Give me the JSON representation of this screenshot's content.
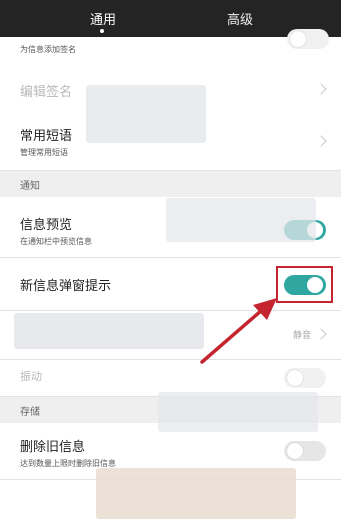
{
  "tabs": [
    {
      "label": "通用"
    },
    {
      "label": "高级"
    }
  ],
  "rows": {
    "signature_sub": "为信息添加签名",
    "edit_signature": "编辑签名",
    "common_phrases": {
      "title": "常用短语",
      "sub": "管理常用短语"
    },
    "preview": {
      "title": "信息预览",
      "sub": "在通知栏中预览信息"
    },
    "popup": {
      "title": "新信息弹窗提示"
    },
    "ringtone_value": "静音",
    "vibrate": {
      "title": "振动"
    },
    "delete_old": {
      "title": "删除旧信息",
      "sub": "达到数量上限时删除旧信息"
    }
  },
  "sections": {
    "notify": "通知",
    "storage": "存储"
  },
  "toggles": {
    "signature": false,
    "preview": true,
    "popup": true,
    "vibrate": false,
    "delete_old": false
  },
  "colors": {
    "tab_bar": "#242424",
    "toggle_on": "#2fa7a0",
    "highlight_annotation": "#c4252f"
  },
  "icons": [
    "chevron-right-icon",
    "annotation-arrow-icon"
  ]
}
